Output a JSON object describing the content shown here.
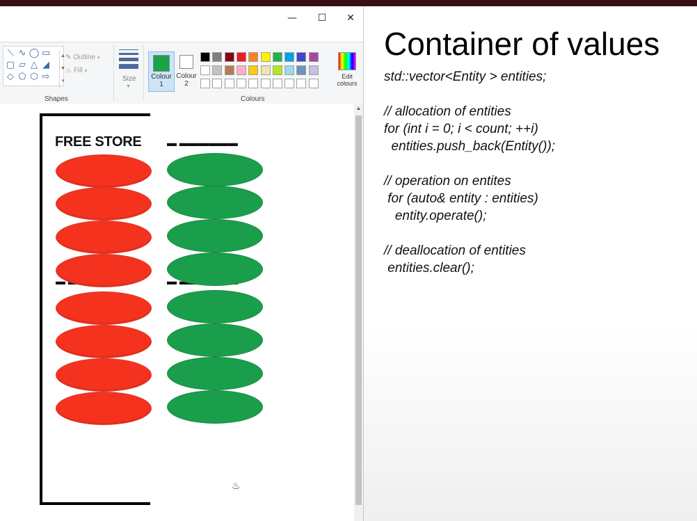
{
  "ribbon": {
    "outline_label": "Outline",
    "fill_label": "Fill",
    "shapes_group": "Shapes",
    "size_label": "Size",
    "colour1_label": "Colour\n1",
    "colour1_line1": "Colour",
    "colour1_line2": "1",
    "colour2_line1": "Colour",
    "colour2_line2": "2",
    "colours_group": "Colours",
    "edit_line1": "Edit",
    "edit_line2": "colours",
    "colour1_value": "#1ba34a",
    "colour2_value": "#ffffff",
    "palette_row1": [
      "#000000",
      "#7f7f7f",
      "#880015",
      "#ed1c24",
      "#ff7f27",
      "#fff200",
      "#22b14c",
      "#00a2e8",
      "#3f48cc",
      "#a349a4"
    ],
    "palette_row2": [
      "#ffffff",
      "#c3c3c3",
      "#b97a57",
      "#ffaec9",
      "#ffc90e",
      "#efe4b0",
      "#b5e61d",
      "#99d9ea",
      "#7092be",
      "#c8bfe7"
    ]
  },
  "canvas": {
    "label": "FREE STORE",
    "red_color": "#f5321e",
    "green_color": "#1b9e4b"
  },
  "slide": {
    "title": "Container of values",
    "code": [
      "std::vector<Entity > entities;",
      "",
      "// allocation of entities",
      "for (int i = 0; i < count; ++i)",
      "  entities.push_back(Entity());",
      "",
      "// operation on entites",
      " for (auto& entity : entities)",
      "   entity.operate();",
      "",
      "// deallocation of entities",
      " entities.clear();"
    ]
  }
}
